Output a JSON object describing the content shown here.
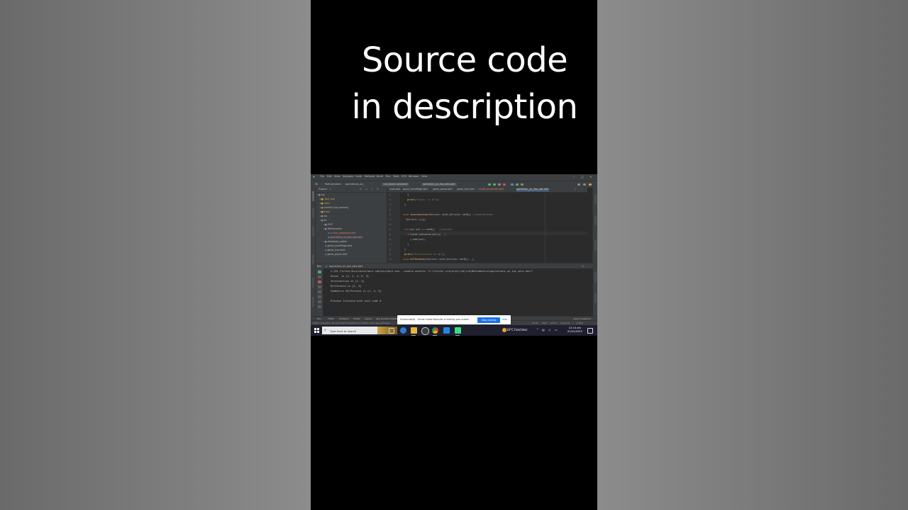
{
  "overlay": {
    "caption_line1": "Source code",
    "caption_line2": "in description"
  },
  "ide": {
    "menu": [
      "File",
      "Edit",
      "View",
      "Navigate",
      "Code",
      "Refactor",
      "Build",
      "Run",
      "Tools",
      "VCS",
      "Window",
      "Help"
    ],
    "breadcrumbs": [
      "lib",
      "Mathematics",
      "operations_on_"
    ],
    "device_selector": "<no device selected>",
    "run_config": "operations_on_two_sets.dart",
    "project_panel_title": "Project",
    "project_tree": [
      {
        "label": "lud",
        "indent": 0
      },
      {
        "label": ".dart_tool",
        "indent": 1
      },
      {
        "label": ".idea",
        "indent": 1
      },
      {
        "label": "android [lud_android]",
        "indent": 1
      },
      {
        "label": "build",
        "indent": 1
      },
      {
        "label": "ios",
        "indent": 1
      },
      {
        "label": "lib",
        "indent": 1
      },
      {
        "label": "OOP",
        "indent": 2
      },
      {
        "label": "Mathematics",
        "indent": 2
      },
      {
        "label": "cricket_properties.dart",
        "indent": 3
      },
      {
        "label": "operations_on_two_sets.dart",
        "indent": 3
      },
      {
        "label": "dropdown_states",
        "indent": 2
      },
      {
        "label": "game_homePage.dart",
        "indent": 2
      },
      {
        "label": "game_icon.dart",
        "indent": 2
      },
      {
        "label": "game_player.dart",
        "indent": 2
      }
    ],
    "editor_tabs": [
      "main.dart",
      "game_homePage.dart",
      "game_player.dart",
      "game_icon.dart",
      "cricket_properties.dart",
      "operations_on_two_sets.dart"
    ],
    "active_tab_index": 5,
    "line_numbers": [
      "37",
      "38",
      "39",
      "40",
      "41",
      "42",
      "43",
      "44",
      "45",
      "46",
      "47",
      "48",
      "49",
      "50",
      "51",
      "52"
    ],
    "run_tab_label": "operations_on_two_sets.dart",
    "run_label": "Run",
    "console_lines": [
      "C:/Dt_Flutter/bin/cache/dart-sdk/bin/dart.exe --enable-asserts \"C:\\flutter projects\\lud\\lib\\Mathematics\\operations_on_two_sets.dart\"",
      "Union  is {1, 2, 4, 6, 5}",
      "Intersection is {1, 4}",
      "Difference is {1, 4}",
      "Symmetric Difference is {1, 4, 5}",
      "",
      "Process finished with exit code 0"
    ],
    "bottom_tabs": [
      "Run",
      "TODO",
      "Problems",
      "Flutter",
      "Logcat",
      "App Quality Insights",
      "Terminal"
    ],
    "bottom_right_tab": "Layout Inspector",
    "status_left": "Kotlin code style: Do you want to update your kotlin code style settings?",
    "status_right": [
      "43:36",
      "CRLF",
      "UTF-8",
      "2 spaces",
      "master"
    ]
  },
  "share_bar": {
    "text": "Screencastify - Screen Video Recorder is sharing your screen.",
    "stop_label": "Stop sharing",
    "hide_label": "Hide"
  },
  "taskbar": {
    "search_placeholder": "Type here to search",
    "weather": "16°C  Fair/clear",
    "time": "12:14 am",
    "date": "01/12/2023"
  },
  "colors": {
    "ide_bg": "#2b2b2b",
    "ide_panel": "#3c3f41",
    "keyword": "#cc7832",
    "function": "#ffc66d",
    "string": "#6a8759",
    "share_button": "#1a73e8"
  }
}
